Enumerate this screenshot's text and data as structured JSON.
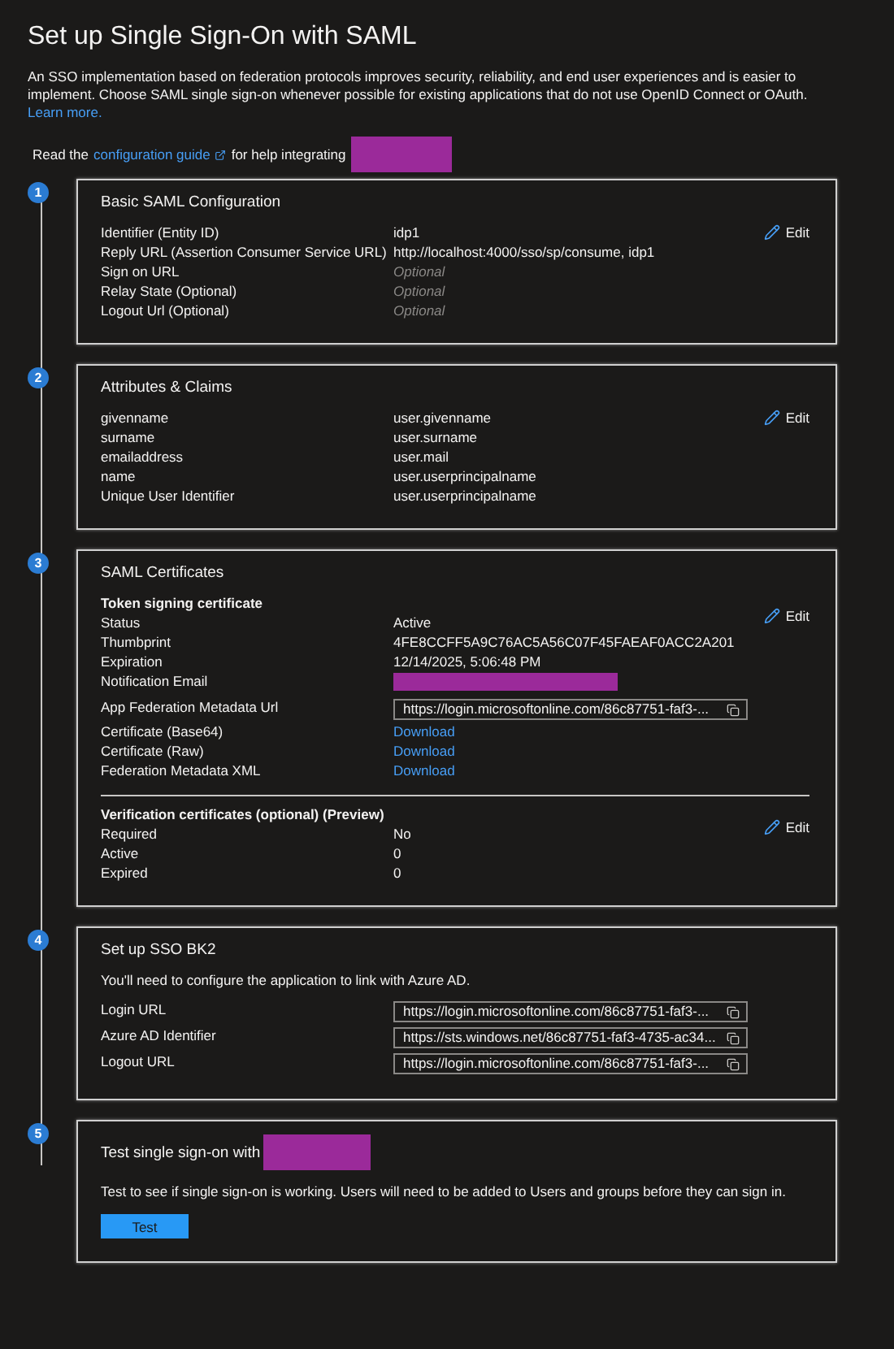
{
  "title": "Set up Single Sign-On with SAML",
  "intro": {
    "text": "An SSO implementation based on federation protocols improves security, reliability, and end user experiences and is easier to implement. Choose SAML single sign-on whenever possible for existing applications that do not use OpenID Connect or OAuth.",
    "link": "Learn more."
  },
  "guide": {
    "before": "Read the",
    "link": "configuration guide",
    "after": "for help integrating",
    "redacted": true
  },
  "steps": [
    {
      "number": "1",
      "title": "Basic SAML Configuration",
      "blocks": [
        {
          "kind": "rows",
          "edit": "Edit",
          "rows": [
            {
              "label": "Identifier (Entity ID)",
              "value": "idp1",
              "kind": "text"
            },
            {
              "label": "Reply URL (Assertion Consumer Service URL)",
              "value": "http://localhost:4000/sso/sp/consume, idp1",
              "kind": "text"
            },
            {
              "label": "Sign on URL",
              "value": "Optional",
              "kind": "optional"
            },
            {
              "label": "Relay State (Optional)",
              "value": "Optional",
              "kind": "optional"
            },
            {
              "label": "Logout Url (Optional)",
              "value": "Optional",
              "kind": "optional"
            }
          ]
        }
      ]
    },
    {
      "number": "2",
      "title": "Attributes & Claims",
      "blocks": [
        {
          "kind": "rows",
          "edit": "Edit",
          "rows": [
            {
              "label": "givenname",
              "value": "user.givenname",
              "kind": "text"
            },
            {
              "label": "surname",
              "value": "user.surname",
              "kind": "text"
            },
            {
              "label": "emailaddress",
              "value": "user.mail",
              "kind": "text"
            },
            {
              "label": "name",
              "value": "user.userprincipalname",
              "kind": "text"
            },
            {
              "label": "Unique User Identifier",
              "value": "user.userprincipalname",
              "kind": "text"
            }
          ]
        }
      ]
    },
    {
      "number": "3",
      "title": "SAML Certificates",
      "blocks": [
        {
          "kind": "rows",
          "heading": "Token signing certificate",
          "edit": "Edit",
          "rows": [
            {
              "label": "Status",
              "value": "Active",
              "kind": "text"
            },
            {
              "label": "Thumbprint",
              "value": "4FE8CCFF5A9C76AC5A56C07F45FAEAF0ACC2A201",
              "kind": "text"
            },
            {
              "label": "Expiration",
              "value": "12/14/2025, 5:06:48 PM",
              "kind": "text"
            },
            {
              "label": "Notification Email",
              "kind": "redacted"
            },
            {
              "label": "App Federation Metadata Url",
              "value": "https://login.microsoftonline.com/86c87751-faf3-...",
              "kind": "field"
            },
            {
              "label": "Certificate (Base64)",
              "value": "Download",
              "kind": "link"
            },
            {
              "label": "Certificate (Raw)",
              "value": "Download",
              "kind": "link"
            },
            {
              "label": "Federation Metadata XML",
              "value": "Download",
              "kind": "link"
            }
          ]
        },
        {
          "kind": "divider"
        },
        {
          "kind": "rows",
          "heading": "Verification certificates (optional) (Preview)",
          "edit": "Edit",
          "rows": [
            {
              "label": "Required",
              "value": "No",
              "kind": "text"
            },
            {
              "label": "Active",
              "value": "0",
              "kind": "text"
            },
            {
              "label": "Expired",
              "value": "0",
              "kind": "text"
            }
          ]
        }
      ]
    },
    {
      "number": "4",
      "title": "Set up SSO BK2",
      "blocks": [
        {
          "kind": "text",
          "text": "You'll need to configure the application to link with Azure AD."
        },
        {
          "kind": "rows",
          "rows": [
            {
              "label": "Login URL",
              "value": "https://login.microsoftonline.com/86c87751-faf3-...",
              "kind": "field"
            },
            {
              "label": "Azure AD Identifier",
              "value": "https://sts.windows.net/86c87751-faf3-4735-ac34...",
              "kind": "field"
            },
            {
              "label": "Logout URL",
              "value": "https://login.microsoftonline.com/86c87751-faf3-...",
              "kind": "field"
            }
          ]
        }
      ]
    },
    {
      "number": "5",
      "title": "Test single sign-on with",
      "title_redacted": true,
      "blocks": [
        {
          "kind": "text",
          "text": "Test to see if single sign-on is working. Users will need to be added to Users and groups before they can sign in."
        },
        {
          "kind": "button",
          "label": "Test"
        }
      ]
    }
  ]
}
